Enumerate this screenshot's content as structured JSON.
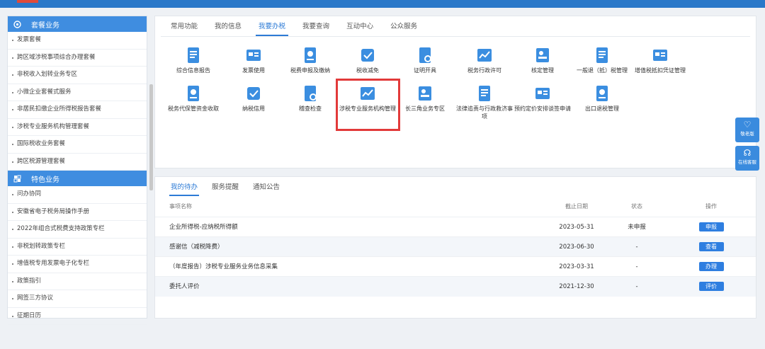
{
  "sidebar": {
    "section1": {
      "title": "套餐业务",
      "items": [
        "发票套餐",
        "跨区域涉税事项综合办理套餐",
        "非税收入划转业务专区",
        "小微企业套餐式服务",
        "非居民扣缴企业所得税报告套餐",
        "涉税专业服务机构管理套餐",
        "国际税收业务套餐",
        "跨区税源管理套餐"
      ]
    },
    "section2": {
      "title": "特色业务",
      "items": [
        "问办协同",
        "安徽省电子税务局操作手册",
        "2022年组合式税费支持政策专栏",
        "非税划转政策专栏",
        "增值税专用发票电子化专栏",
        "政策指引",
        "网签三方协议",
        "征期日历"
      ]
    }
  },
  "main": {
    "tabs": [
      "常用功能",
      "我的信息",
      "我要办税",
      "我要查询",
      "互动中心",
      "公众服务"
    ],
    "functions": [
      {
        "label": "综合信息报告",
        "icon": "report-icon",
        "color": "#3b8ee0"
      },
      {
        "label": "发票使用",
        "icon": "invoice-icon",
        "color": "#3b8ee0"
      },
      {
        "label": "税费申报及缴纳",
        "icon": "declare-icon",
        "color": "#3b8ee0"
      },
      {
        "label": "税收减免",
        "icon": "tax-relief-icon",
        "color": "#3b8ee0"
      },
      {
        "label": "证明开具",
        "icon": "certificate-icon",
        "color": "#3b8ee0"
      },
      {
        "label": "税务行政许可",
        "icon": "license-icon",
        "color": "#3b8ee0"
      },
      {
        "label": "核定管理",
        "icon": "approval-icon",
        "color": "#3b8ee0"
      },
      {
        "label": "一般退（抵）税管理",
        "icon": "refund-icon",
        "color": "#3b8ee0"
      },
      {
        "label": "增值税抵扣凭证管理",
        "icon": "voucher-icon",
        "color": "#3b8ee0"
      },
      {
        "label": "税务代保管资金收取",
        "icon": "custody-icon",
        "color": "#3b8ee0"
      },
      {
        "label": "纳税信用",
        "icon": "credit-icon",
        "color": "#3b8ee0"
      },
      {
        "label": "稽查检查",
        "icon": "inspection-icon",
        "color": "#3b8ee0"
      },
      {
        "label": "涉税专业服务机构管理",
        "icon": "agency-icon",
        "color": "#3b8ee0"
      },
      {
        "label": "长三角业务专区",
        "icon": "yangtze-icon",
        "color": "#3b8ee0"
      },
      {
        "label": "法律追责与行政救济事项",
        "icon": "legal-icon",
        "color": "#3b8ee0"
      },
      {
        "label": "预约定价安排谈签申请",
        "icon": "pricing-icon",
        "color": "#3b8ee0"
      },
      {
        "label": "出口退税管理",
        "icon": "export-icon",
        "color": "#3b8ee0"
      }
    ]
  },
  "tasks": {
    "tabs": [
      "我的待办",
      "服务提醒",
      "通知公告"
    ],
    "headers": {
      "name": "事项名称",
      "date": "截止日期",
      "status": "状态",
      "op": "操作"
    },
    "rows": [
      {
        "name": "企业所得税-应纳税所得额",
        "date": "2023-05-31",
        "status": "未申报",
        "op": "申报"
      },
      {
        "name": "感谢信（减税降费）",
        "date": "2023-06-30",
        "status": "-",
        "op": "查看"
      },
      {
        "name": "（年度报告）涉税专业服务业务信息采集",
        "date": "2023-03-31",
        "status": "-",
        "op": "办理"
      },
      {
        "name": "委托人评价",
        "date": "2021-12-30",
        "status": "-",
        "op": "评价"
      }
    ]
  },
  "floating": {
    "elder": "敬老版",
    "service": "在线客服"
  },
  "colors": {
    "primary": "#2e7ee0",
    "highlight": "#e23a3a",
    "header": "#3f8de0"
  }
}
